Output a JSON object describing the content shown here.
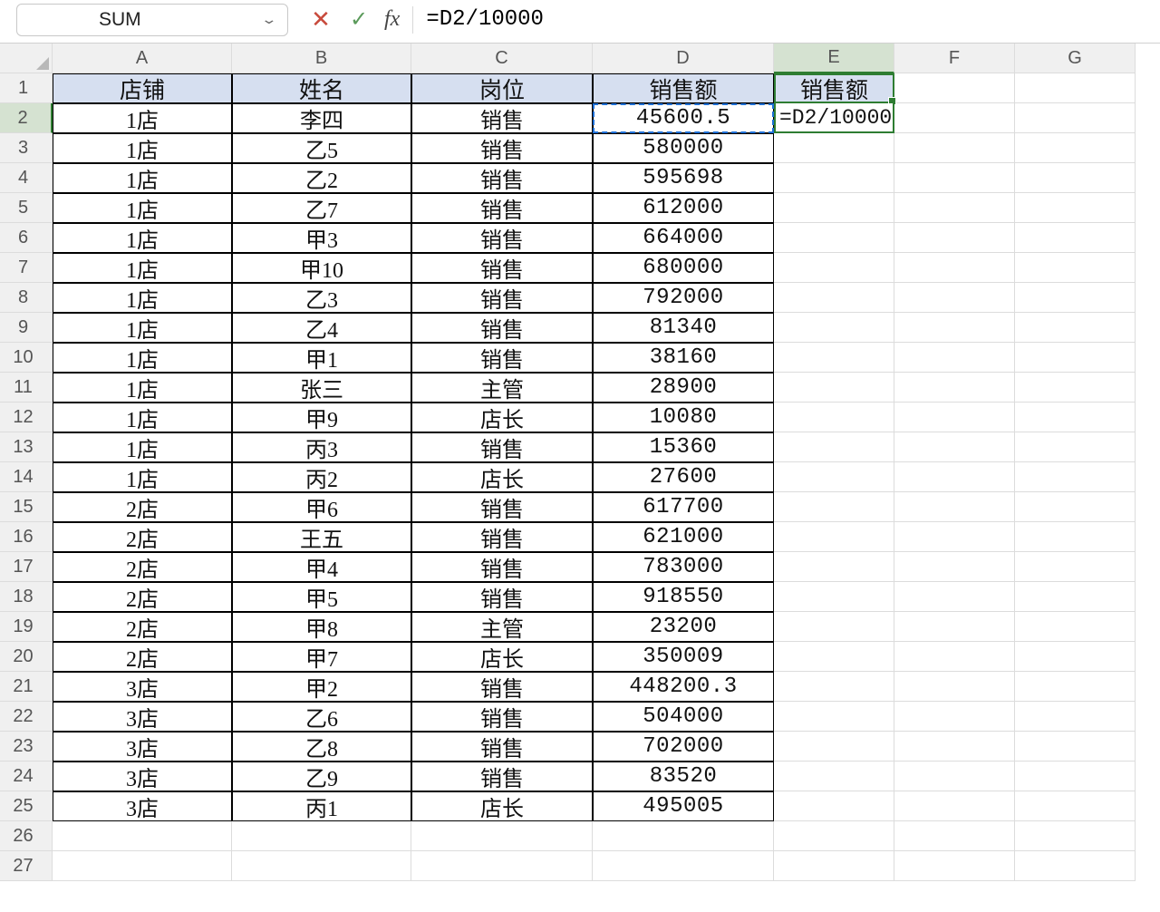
{
  "formula_bar": {
    "cell_ref": "SUM",
    "formula": "=D2/10000",
    "fx_label": "fx",
    "cancel_glyph": "✕",
    "enter_glyph": "✓",
    "chevron_glyph": "⌄"
  },
  "column_letters": [
    "A",
    "B",
    "C",
    "D",
    "E",
    "F",
    "G"
  ],
  "row_numbers": [
    "1",
    "2",
    "3",
    "4",
    "5",
    "6",
    "7",
    "8",
    "9",
    "10",
    "11",
    "12",
    "13",
    "14",
    "15",
    "16",
    "17",
    "18",
    "19",
    "20",
    "21",
    "22",
    "23",
    "24",
    "25",
    "26",
    "27"
  ],
  "headers": {
    "A": "店铺",
    "B": "姓名",
    "C": "岗位",
    "D": "销售额",
    "E": "销售额"
  },
  "e2_display": "=D2/10000",
  "rows": [
    {
      "a": "1店",
      "b": "李四",
      "c": "销售",
      "d": "45600.5"
    },
    {
      "a": "1店",
      "b": "乙5",
      "c": "销售",
      "d": "580000"
    },
    {
      "a": "1店",
      "b": "乙2",
      "c": "销售",
      "d": "595698"
    },
    {
      "a": "1店",
      "b": "乙7",
      "c": "销售",
      "d": "612000"
    },
    {
      "a": "1店",
      "b": "甲3",
      "c": "销售",
      "d": "664000"
    },
    {
      "a": "1店",
      "b": "甲10",
      "c": "销售",
      "d": "680000"
    },
    {
      "a": "1店",
      "b": "乙3",
      "c": "销售",
      "d": "792000"
    },
    {
      "a": "1店",
      "b": "乙4",
      "c": "销售",
      "d": "81340"
    },
    {
      "a": "1店",
      "b": "甲1",
      "c": "销售",
      "d": "38160"
    },
    {
      "a": "1店",
      "b": "张三",
      "c": "主管",
      "d": "28900"
    },
    {
      "a": "1店",
      "b": "甲9",
      "c": "店长",
      "d": "10080"
    },
    {
      "a": "1店",
      "b": "丙3",
      "c": "销售",
      "d": "15360"
    },
    {
      "a": "1店",
      "b": "丙2",
      "c": "店长",
      "d": "27600"
    },
    {
      "a": "2店",
      "b": "甲6",
      "c": "销售",
      "d": "617700"
    },
    {
      "a": "2店",
      "b": "王五",
      "c": "销售",
      "d": "621000"
    },
    {
      "a": "2店",
      "b": "甲4",
      "c": "销售",
      "d": "783000"
    },
    {
      "a": "2店",
      "b": "甲5",
      "c": "销售",
      "d": "918550"
    },
    {
      "a": "2店",
      "b": "甲8",
      "c": "主管",
      "d": "23200"
    },
    {
      "a": "2店",
      "b": "甲7",
      "c": "店长",
      "d": "350009"
    },
    {
      "a": "3店",
      "b": "甲2",
      "c": "销售",
      "d": "448200.3"
    },
    {
      "a": "3店",
      "b": "乙6",
      "c": "销售",
      "d": "504000"
    },
    {
      "a": "3店",
      "b": "乙8",
      "c": "销售",
      "d": "702000"
    },
    {
      "a": "3店",
      "b": "乙9",
      "c": "销售",
      "d": "83520"
    },
    {
      "a": "3店",
      "b": "丙1",
      "c": "店长",
      "d": "495005"
    }
  ]
}
